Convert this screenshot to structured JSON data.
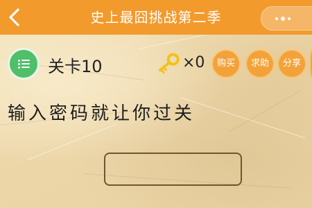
{
  "header": {
    "title": "史上最囧挑战第二季",
    "bg_color": "#f39a2d"
  },
  "level_bar": {
    "level_label": "关卡10",
    "key_count": "×0",
    "buttons": [
      {
        "label": "购买"
      },
      {
        "label": "求助"
      },
      {
        "label": "分享"
      }
    ]
  },
  "puzzle": {
    "prompt": "输入密码就让你过关",
    "answer_value": ""
  },
  "icons": {
    "back": "chevron-left-icon",
    "more": "more-dots-icon",
    "menu": "list-menu-icon",
    "key": "key-icon"
  }
}
